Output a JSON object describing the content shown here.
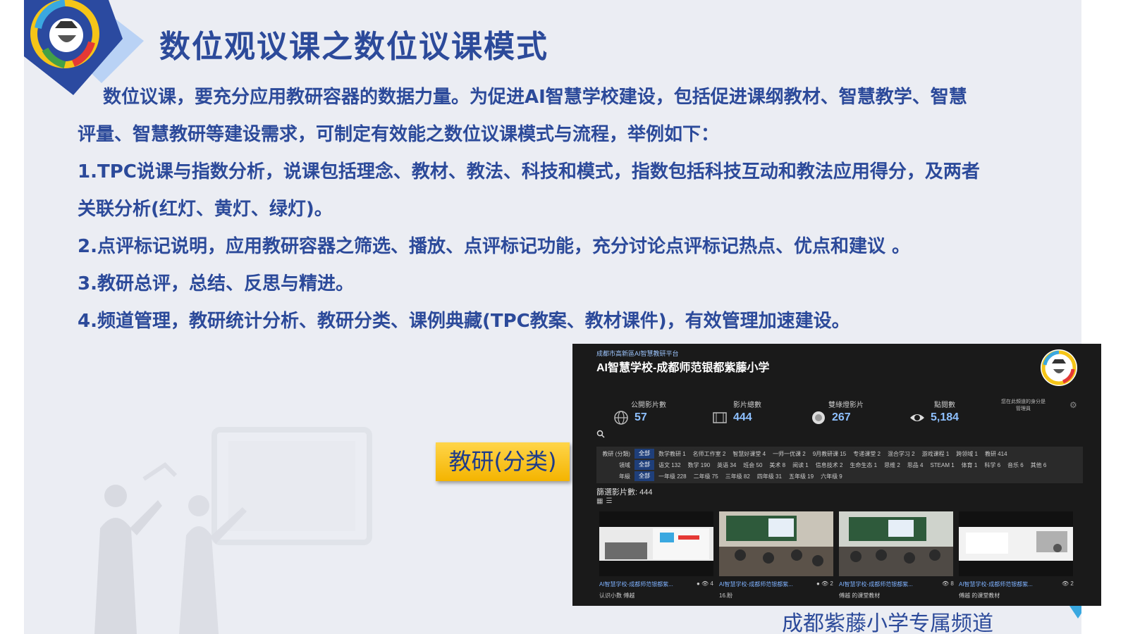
{
  "slide": {
    "title": "数位观议课之数位议课模式",
    "lines": [
      "数位议课，要充分应用教研容器的数据力量。为促进AI智慧学校建设，包括促进课纲教材、智慧教学、智慧",
      "评量、智慧教研等建设需求，可制定有效能之数位议课模式与流程，举例如下：",
      "1.TPC说课与指数分析，说课包括理念、教材、教法、科技和模式，指数包括科技互动和教法应用得分，及两者",
      "关联分析(红灯、黄灯、绿灯)。",
      "2.点评标记说明，应用教研容器之筛选、播放、点评标记功能，充分讨论点评标记热点、优点和建议 。",
      "3.教研总评，总结、反思与精进。",
      "4.频道管理，教研统计分析、教研分类、课例典藏(TPC教案、教材课件)，有效管理加速建设。"
    ],
    "callout": "教研(分类)",
    "channel_caption": "成都紫藤小学专属频道"
  },
  "screenshot": {
    "org": "成都市高新區AI智慧教研平台",
    "school": "AI智慧学校-成都师范银都紫藤小学",
    "stats": [
      {
        "label": "公開影片數",
        "value": "57",
        "icon": "globe-icon"
      },
      {
        "label": "影片總數",
        "value": "444",
        "icon": "film-icon"
      },
      {
        "label": "雙綠燈影片",
        "value": "267",
        "icon": "disc-icon"
      },
      {
        "label": "點閱數",
        "value": "5,184",
        "icon": "eye-icon"
      }
    ],
    "role_line1": "您在此頻道的身分是",
    "role_line2": "管理員",
    "filters": [
      {
        "label": "教研 (分類)",
        "all": "全部",
        "options": [
          "数学教研 1",
          "名师工作室 2",
          "智慧好课堂 4",
          "一师一优课 2",
          "9月教研课 15",
          "专递课堂 2",
          "混合学习 2",
          "游戏课程 1",
          "跨领域 1",
          "教研 414"
        ]
      },
      {
        "label": "領域",
        "all": "全部",
        "options": [
          "语文 132",
          "数学 190",
          "英语 34",
          "班会 50",
          "美术 8",
          "阅读 1",
          "信息技术 2",
          "生命生态 1",
          "思维 2",
          "思品 4",
          "STEAM 1",
          "体育 1",
          "科学 6",
          "音乐 6",
          "其他 6"
        ]
      },
      {
        "label": "年級",
        "all": "全部",
        "options": [
          "一年级 228",
          "二年级 75",
          "三年级 82",
          "四年级 31",
          "五年级 19",
          "六年级 9"
        ]
      }
    ],
    "count_text": "篩選影片數: 444",
    "videos": [
      {
        "title": "AI智慧学校-成都师范银都紫...",
        "sub": "认识小数 傅越",
        "meta": "● 👁 4"
      },
      {
        "title": "AI智慧学校-成都师范银都紫...",
        "sub": "16.盼",
        "meta": "● 👁 2"
      },
      {
        "title": "AI智慧学校-成都师范银都紫...",
        "sub": "傅越 的课堂教材",
        "meta": "👁 8"
      },
      {
        "title": "AI智慧学校-成都师范银都紫...",
        "sub": "傅越 的课堂教材",
        "meta": "👁 2"
      }
    ]
  }
}
